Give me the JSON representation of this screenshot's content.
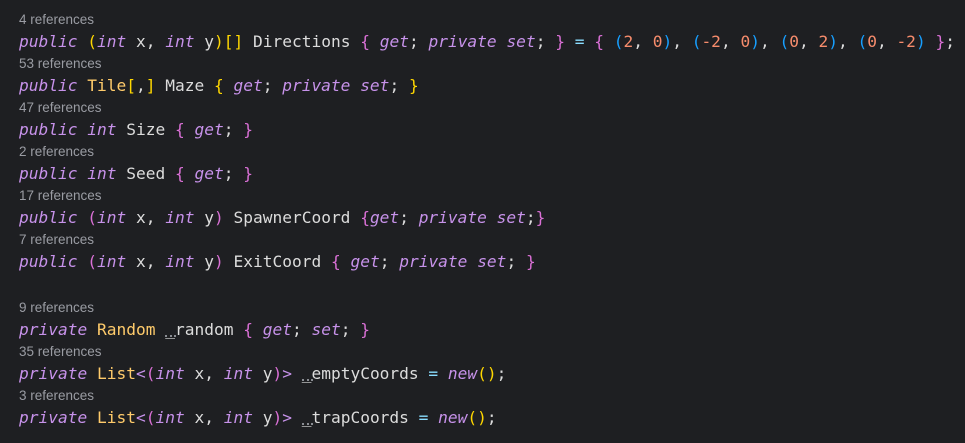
{
  "kw": {
    "public": "public",
    "private": "private",
    "int": "int",
    "get": "get",
    "set": "set",
    "new": "new"
  },
  "lines": [
    {
      "refs": "4 references",
      "id": "Directions",
      "lx": "x",
      "ly": "y",
      "values": [
        "2",
        "0",
        "-2",
        "0",
        "0",
        "2",
        "0",
        "-2"
      ]
    },
    {
      "refs": "53 references",
      "type": "Tile",
      "id": "Maze"
    },
    {
      "refs": "47 references",
      "id": "Size"
    },
    {
      "refs": "2 references",
      "id": "Seed"
    },
    {
      "refs": "17 references",
      "lx": "x",
      "ly": "y",
      "id": "SpawnerCoord"
    },
    {
      "refs": "7 references",
      "lx": "x",
      "ly": "y",
      "id": "ExitCoord"
    },
    {
      "refs": "9 references",
      "type": "Random",
      "id": "_random"
    },
    {
      "refs": "35 references",
      "type": "List",
      "lx": "x",
      "ly": "y",
      "id": "_emptyCoords"
    },
    {
      "refs": "3 references",
      "type": "List",
      "lx": "x",
      "ly": "y",
      "id": "_trapCoords"
    }
  ]
}
